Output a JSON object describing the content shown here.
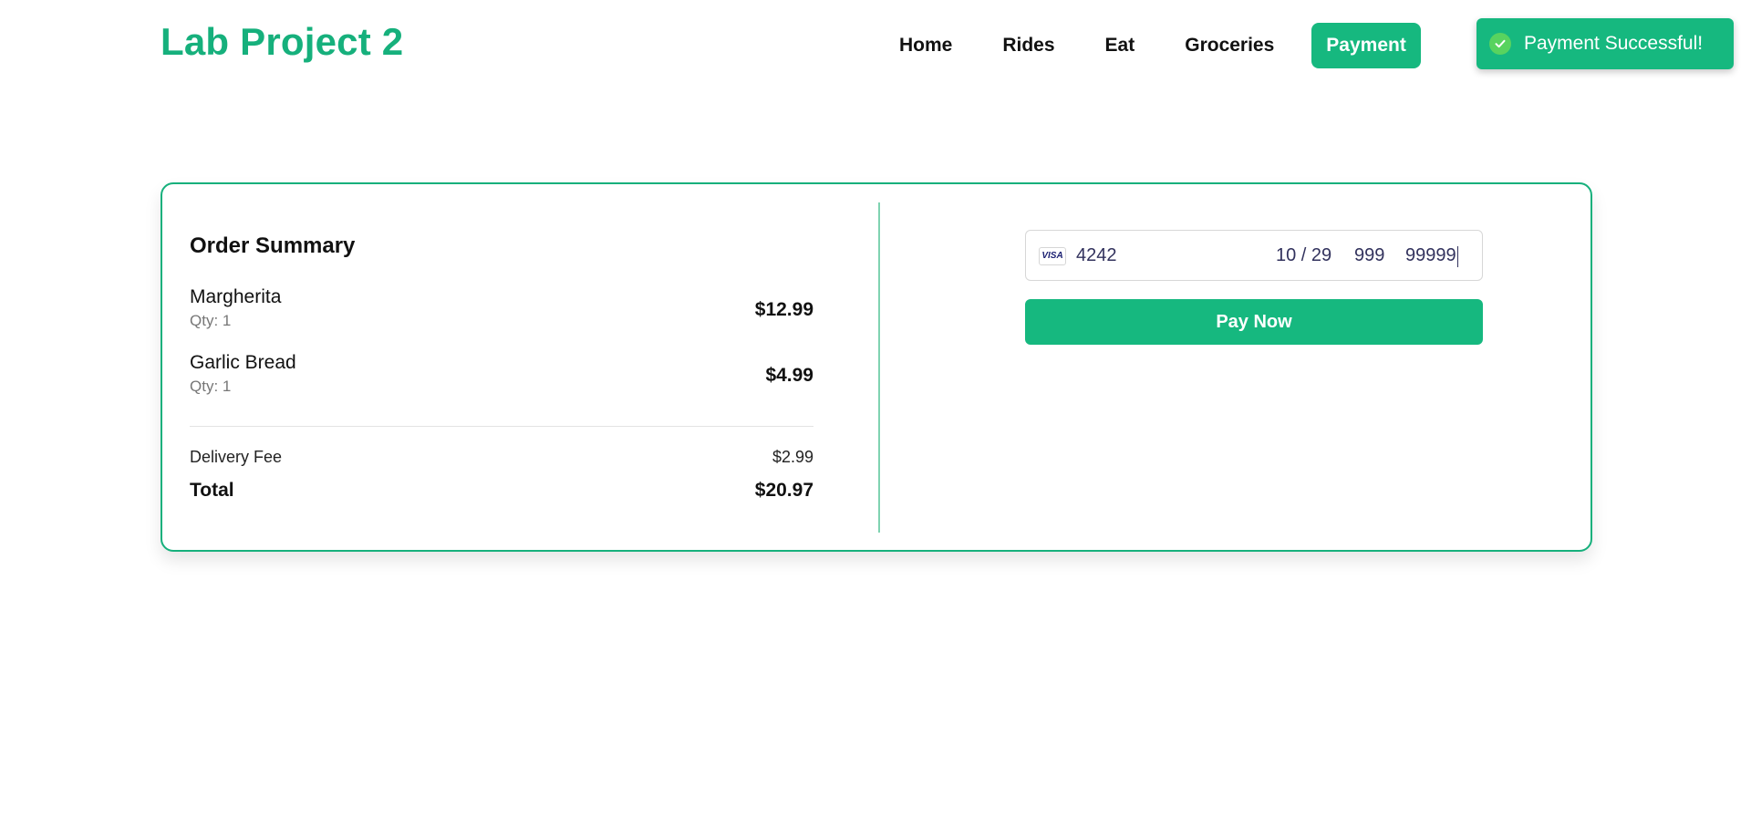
{
  "brand": {
    "title": "Lab Project 2"
  },
  "nav": {
    "items": [
      "Home",
      "Rides",
      "Eat",
      "Groceries"
    ],
    "active": "Payment"
  },
  "toast": {
    "message": "Payment Successful!",
    "icon": "check-circle-icon",
    "color": "#16b87f"
  },
  "order": {
    "title": "Order Summary",
    "items": [
      {
        "name": "Margherita",
        "qty": "Qty: 1",
        "price": "$12.99"
      },
      {
        "name": "Garlic Bread",
        "qty": "Qty: 1",
        "price": "$4.99"
      }
    ],
    "delivery_label": "Delivery Fee",
    "delivery_value": "$2.99",
    "total_label": "Total",
    "total_value": "$20.97"
  },
  "payment": {
    "card_brand": "VISA",
    "card_number": "4242",
    "expiry": "10 / 29",
    "cvc": "999",
    "zip": "99999",
    "pay_button": "Pay Now"
  },
  "colors": {
    "accent": "#16b07c",
    "button": "#16b87f"
  }
}
